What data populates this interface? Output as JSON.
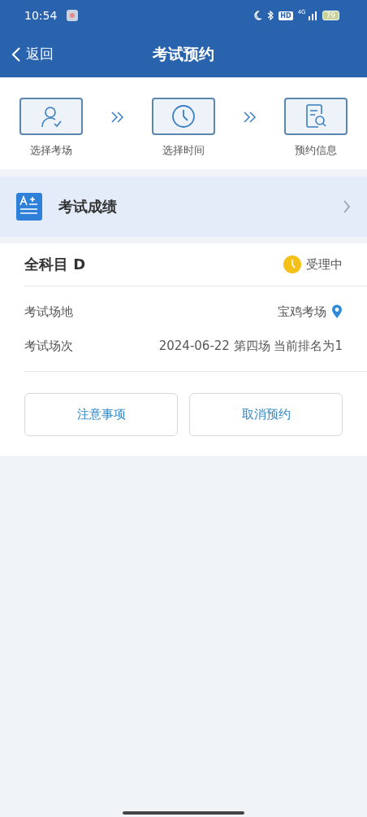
{
  "status_bar": {
    "time": "10:54",
    "hd_badge": "HD",
    "network": "4G",
    "battery": "79"
  },
  "header": {
    "back": "返回",
    "title": "考试预约"
  },
  "steps": [
    {
      "kind": "person",
      "label": "选择考场"
    },
    {
      "kind": "clock",
      "label": "选择时间"
    },
    {
      "kind": "document",
      "label": "预约信息"
    }
  ],
  "score_row": {
    "label": "考试成绩"
  },
  "booking": {
    "subject": "全科目 D",
    "status": "受理中",
    "fields": [
      {
        "label": "考试场地",
        "value": "宝鸡考场",
        "kind": "location"
      },
      {
        "label": "考试场次",
        "value": "2024-06-22 第四场 当前排名为1",
        "kind": "text"
      }
    ],
    "buttons": [
      "注意事项",
      "取消预约"
    ]
  }
}
